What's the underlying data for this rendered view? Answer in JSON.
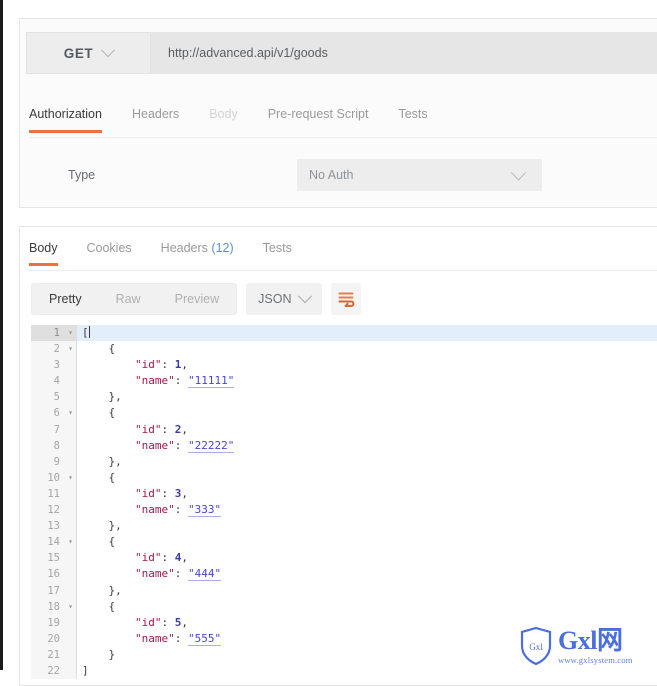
{
  "request": {
    "method": "GET",
    "url": "http://advanced.api/v1/goods",
    "tabs": [
      {
        "label": "Authorization",
        "state": "active"
      },
      {
        "label": "Headers",
        "state": "normal"
      },
      {
        "label": "Body",
        "state": "muted"
      },
      {
        "label": "Pre-request Script",
        "state": "normal"
      },
      {
        "label": "Tests",
        "state": "normal"
      }
    ],
    "auth": {
      "type_label": "Type",
      "type_value": "No Auth"
    }
  },
  "response": {
    "tabs": [
      {
        "label": "Body",
        "state": "active",
        "count": ""
      },
      {
        "label": "Cookies",
        "state": "normal",
        "count": ""
      },
      {
        "label": "Headers",
        "state": "normal",
        "count": "(12)"
      },
      {
        "label": "Tests",
        "state": "normal",
        "count": ""
      }
    ],
    "toolbar": {
      "formats": [
        {
          "label": "Pretty",
          "state": "active"
        },
        {
          "label": "Raw",
          "state": "normal"
        },
        {
          "label": "Preview",
          "state": "normal"
        }
      ],
      "language": "JSON",
      "wrap_icon": "word-wrap-icon"
    },
    "body_json": [
      {
        "id": 1,
        "name": "11111"
      },
      {
        "id": 2,
        "name": "22222"
      },
      {
        "id": 3,
        "name": "333"
      },
      {
        "id": 4,
        "name": "444"
      },
      {
        "id": 5,
        "name": "555"
      }
    ],
    "editor_lines": [
      {
        "n": "1",
        "fold": "▾",
        "active": true,
        "indent": 0,
        "tokens": [
          {
            "t": "punc",
            "v": "["
          }
        ],
        "caret": true
      },
      {
        "n": "2",
        "fold": "▾",
        "active": false,
        "indent": 1,
        "tokens": [
          {
            "t": "punc",
            "v": "{"
          }
        ]
      },
      {
        "n": "3",
        "fold": "",
        "active": false,
        "indent": 2,
        "tokens": [
          {
            "t": "key",
            "v": "\"id\""
          },
          {
            "t": "punc",
            "v": ": "
          },
          {
            "t": "num",
            "v": "1"
          },
          {
            "t": "punc",
            "v": ","
          }
        ]
      },
      {
        "n": "4",
        "fold": "",
        "active": false,
        "indent": 2,
        "tokens": [
          {
            "t": "key",
            "v": "\"name\""
          },
          {
            "t": "punc",
            "v": ": "
          },
          {
            "t": "str",
            "v": "\"11111\""
          }
        ]
      },
      {
        "n": "5",
        "fold": "",
        "active": false,
        "indent": 1,
        "tokens": [
          {
            "t": "punc",
            "v": "},"
          }
        ]
      },
      {
        "n": "6",
        "fold": "▾",
        "active": false,
        "indent": 1,
        "tokens": [
          {
            "t": "punc",
            "v": "{"
          }
        ]
      },
      {
        "n": "7",
        "fold": "",
        "active": false,
        "indent": 2,
        "tokens": [
          {
            "t": "key",
            "v": "\"id\""
          },
          {
            "t": "punc",
            "v": ": "
          },
          {
            "t": "num",
            "v": "2"
          },
          {
            "t": "punc",
            "v": ","
          }
        ]
      },
      {
        "n": "8",
        "fold": "",
        "active": false,
        "indent": 2,
        "tokens": [
          {
            "t": "key",
            "v": "\"name\""
          },
          {
            "t": "punc",
            "v": ": "
          },
          {
            "t": "str",
            "v": "\"22222\""
          }
        ]
      },
      {
        "n": "9",
        "fold": "",
        "active": false,
        "indent": 1,
        "tokens": [
          {
            "t": "punc",
            "v": "},"
          }
        ]
      },
      {
        "n": "10",
        "fold": "▾",
        "active": false,
        "indent": 1,
        "tokens": [
          {
            "t": "punc",
            "v": "{"
          }
        ]
      },
      {
        "n": "11",
        "fold": "",
        "active": false,
        "indent": 2,
        "tokens": [
          {
            "t": "key",
            "v": "\"id\""
          },
          {
            "t": "punc",
            "v": ": "
          },
          {
            "t": "num",
            "v": "3"
          },
          {
            "t": "punc",
            "v": ","
          }
        ]
      },
      {
        "n": "12",
        "fold": "",
        "active": false,
        "indent": 2,
        "tokens": [
          {
            "t": "key",
            "v": "\"name\""
          },
          {
            "t": "punc",
            "v": ": "
          },
          {
            "t": "str",
            "v": "\"333\""
          }
        ]
      },
      {
        "n": "13",
        "fold": "",
        "active": false,
        "indent": 1,
        "tokens": [
          {
            "t": "punc",
            "v": "},"
          }
        ]
      },
      {
        "n": "14",
        "fold": "▾",
        "active": false,
        "indent": 1,
        "tokens": [
          {
            "t": "punc",
            "v": "{"
          }
        ]
      },
      {
        "n": "15",
        "fold": "",
        "active": false,
        "indent": 2,
        "tokens": [
          {
            "t": "key",
            "v": "\"id\""
          },
          {
            "t": "punc",
            "v": ": "
          },
          {
            "t": "num",
            "v": "4"
          },
          {
            "t": "punc",
            "v": ","
          }
        ]
      },
      {
        "n": "16",
        "fold": "",
        "active": false,
        "indent": 2,
        "tokens": [
          {
            "t": "key",
            "v": "\"name\""
          },
          {
            "t": "punc",
            "v": ": "
          },
          {
            "t": "str",
            "v": "\"444\""
          }
        ]
      },
      {
        "n": "17",
        "fold": "",
        "active": false,
        "indent": 1,
        "tokens": [
          {
            "t": "punc",
            "v": "},"
          }
        ]
      },
      {
        "n": "18",
        "fold": "▾",
        "active": false,
        "indent": 1,
        "tokens": [
          {
            "t": "punc",
            "v": "{"
          }
        ]
      },
      {
        "n": "19",
        "fold": "",
        "active": false,
        "indent": 2,
        "tokens": [
          {
            "t": "key",
            "v": "\"id\""
          },
          {
            "t": "punc",
            "v": ": "
          },
          {
            "t": "num",
            "v": "5"
          },
          {
            "t": "punc",
            "v": ","
          }
        ]
      },
      {
        "n": "20",
        "fold": "",
        "active": false,
        "indent": 2,
        "tokens": [
          {
            "t": "key",
            "v": "\"name\""
          },
          {
            "t": "punc",
            "v": ": "
          },
          {
            "t": "str",
            "v": "\"555\""
          }
        ]
      },
      {
        "n": "21",
        "fold": "",
        "active": false,
        "indent": 1,
        "tokens": [
          {
            "t": "punc",
            "v": "}"
          }
        ]
      },
      {
        "n": "22",
        "fold": "",
        "active": false,
        "indent": 0,
        "tokens": [
          {
            "t": "punc",
            "v": "]"
          }
        ]
      }
    ]
  },
  "watermark": {
    "brand": "Gxl网",
    "site": "www.gxlsystem.com",
    "shield_label": "Gxl"
  },
  "colors": {
    "accent_orange": "#e9733a",
    "link_blue": "#5a8fd6",
    "json_key": "#a3174f",
    "json_string": "#4545d6",
    "active_line": "#e3eefb",
    "watermark_blue": "#4a6fdd"
  }
}
